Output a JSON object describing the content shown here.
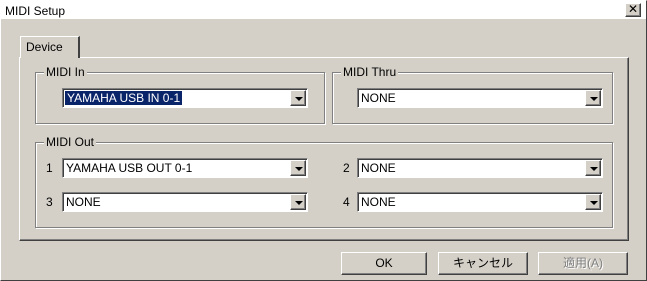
{
  "window": {
    "title": "MIDI Setup",
    "close_glyph": "✕"
  },
  "tabs": [
    {
      "label": "Device"
    }
  ],
  "midi_in": {
    "label": "MIDI In",
    "selected": "YAMAHA USB IN 0-1"
  },
  "midi_thru": {
    "label": "MIDI Thru",
    "selected": "NONE"
  },
  "midi_out": {
    "label": "MIDI Out",
    "ports": [
      {
        "number": "1",
        "selected": "YAMAHA USB OUT 0-1"
      },
      {
        "number": "2",
        "selected": "NONE"
      },
      {
        "number": "3",
        "selected": "NONE"
      },
      {
        "number": "4",
        "selected": "NONE"
      }
    ]
  },
  "buttons": {
    "ok": "OK",
    "cancel": "キャンセル",
    "apply": "適用(A)"
  },
  "icons": {
    "dropdown": "chevron-down-icon",
    "close": "close-icon"
  }
}
